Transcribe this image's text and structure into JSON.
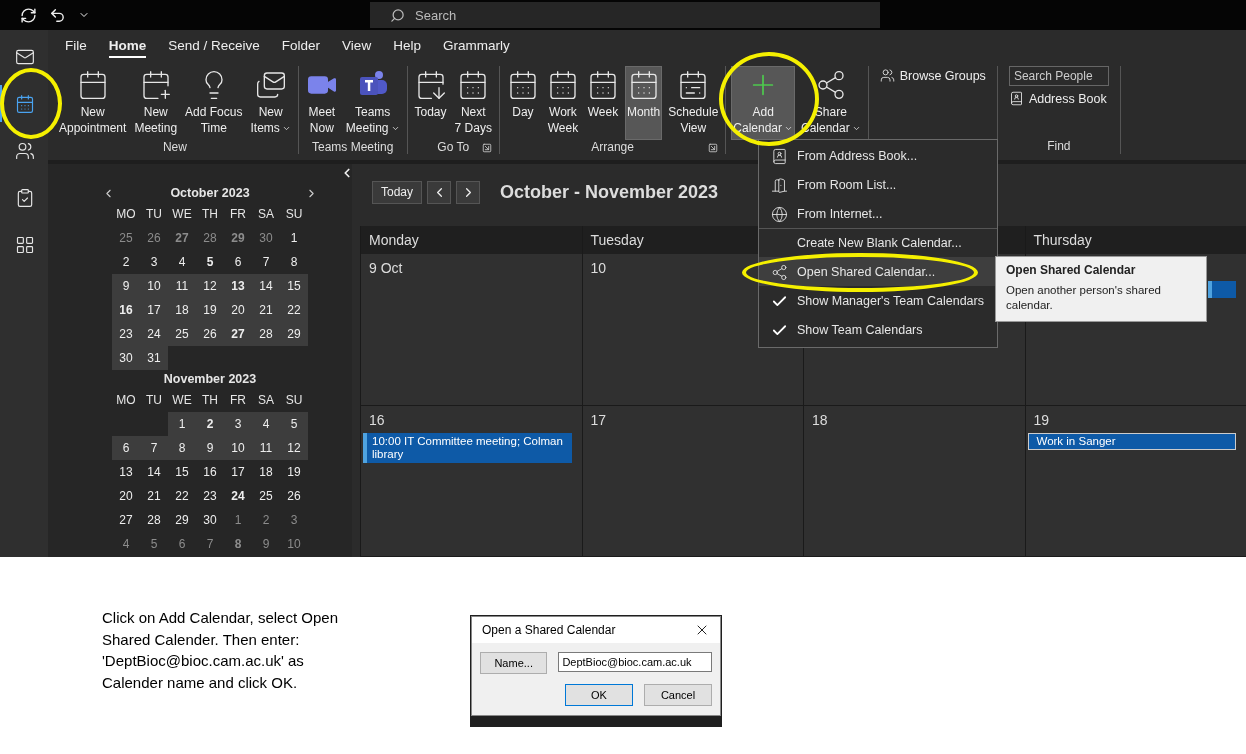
{
  "title_bar": {
    "search_placeholder": "Search"
  },
  "nav_rail": [
    {
      "kind": "mail",
      "selected": false,
      "circled": false
    },
    {
      "kind": "calendar",
      "selected": true,
      "circled": true
    },
    {
      "kind": "people",
      "selected": false,
      "circled": false
    },
    {
      "kind": "tasks",
      "selected": false,
      "circled": false
    },
    {
      "kind": "apps",
      "selected": false,
      "circled": false
    }
  ],
  "ribbon_tabs": [
    {
      "label": "File",
      "selected": false
    },
    {
      "label": "Home",
      "selected": true
    },
    {
      "label": "Send / Receive",
      "selected": false
    },
    {
      "label": "Folder",
      "selected": false
    },
    {
      "label": "View",
      "selected": false
    },
    {
      "label": "Help",
      "selected": false
    },
    {
      "label": "Grammarly",
      "selected": false
    }
  ],
  "ribbon_groups": [
    {
      "label": "New",
      "launcher": false,
      "items": [
        {
          "kind": "large",
          "lines": [
            "New",
            "Appointment"
          ],
          "dropdown": false,
          "selected": false,
          "circled": false
        },
        {
          "kind": "large",
          "lines": [
            "New",
            "Meeting"
          ],
          "dropdown": false,
          "selected": false,
          "circled": false
        },
        {
          "kind": "large",
          "lines": [
            "Add Focus",
            "Time"
          ],
          "dropdown": false,
          "selected": false,
          "circled": false
        },
        {
          "kind": "large",
          "lines": [
            "New",
            "Items"
          ],
          "dropdown": true,
          "selected": false,
          "circled": false
        }
      ]
    },
    {
      "label": "Teams Meeting",
      "launcher": false,
      "items": [
        {
          "kind": "large",
          "lines": [
            "Meet",
            "Now"
          ],
          "dropdown": false,
          "selected": false,
          "circled": false
        },
        {
          "kind": "large",
          "lines": [
            "Teams",
            "Meeting"
          ],
          "dropdown": true,
          "selected": false,
          "circled": false
        }
      ]
    },
    {
      "label": "Go To",
      "launcher": true,
      "items": [
        {
          "kind": "large",
          "lines": [
            "Today"
          ],
          "dropdown": false,
          "selected": false,
          "circled": false
        },
        {
          "kind": "large",
          "lines": [
            "Next",
            "7 Days"
          ],
          "dropdown": false,
          "selected": false,
          "circled": false
        }
      ]
    },
    {
      "label": "Arrange",
      "launcher": true,
      "items": [
        {
          "kind": "large",
          "lines": [
            "Day"
          ],
          "dropdown": false,
          "selected": false,
          "circled": false
        },
        {
          "kind": "large",
          "lines": [
            "Work",
            "Week"
          ],
          "dropdown": false,
          "selected": false,
          "circled": false
        },
        {
          "kind": "large",
          "lines": [
            "Week"
          ],
          "dropdown": false,
          "selected": false,
          "circled": false
        },
        {
          "kind": "large",
          "lines": [
            "Month"
          ],
          "dropdown": false,
          "selected": true,
          "circled": false
        },
        {
          "kind": "large",
          "lines": [
            "Schedule",
            "View"
          ],
          "dropdown": false,
          "selected": false,
          "circled": false
        }
      ]
    },
    {
      "launcher": false,
      "items": [
        {
          "kind": "large",
          "lines": [
            "Add",
            "Calendar"
          ],
          "dropdown": true,
          "selected": true,
          "circled": true
        },
        {
          "kind": "large",
          "lines": [
            "Share",
            "Calendar"
          ],
          "dropdown": true,
          "selected": false,
          "circled": false
        }
      ]
    },
    {
      "launcher": false,
      "items": [
        {
          "kind": "small",
          "text": "Browse Groups"
        }
      ]
    },
    {
      "label": "Find",
      "launcher": false,
      "items": [
        {
          "kind": "field",
          "placeholder": "Search People"
        },
        {
          "kind": "small",
          "text": "Address Book"
        }
      ]
    }
  ],
  "mini_calendars": [
    {
      "title": "October 2023",
      "nav": true,
      "weekdays": [
        "MO",
        "TU",
        "WE",
        "TH",
        "FR",
        "SA",
        "SU"
      ],
      "weeks": [
        [
          {
            "d": "25",
            "muted": true,
            "bold": false,
            "in_view": false
          },
          {
            "d": "26",
            "muted": true,
            "bold": false,
            "in_view": false
          },
          {
            "d": "27",
            "muted": true,
            "bold": true,
            "in_view": false
          },
          {
            "d": "28",
            "muted": true,
            "bold": false,
            "in_view": false
          },
          {
            "d": "29",
            "muted": true,
            "bold": true,
            "in_view": false
          },
          {
            "d": "30",
            "muted": true,
            "bold": false,
            "in_view": false
          },
          {
            "d": "1",
            "muted": false,
            "bold": false,
            "in_view": false
          }
        ],
        [
          {
            "d": "2",
            "muted": false,
            "bold": false,
            "in_view": false
          },
          {
            "d": "3",
            "muted": false,
            "bold": false,
            "in_view": false
          },
          {
            "d": "4",
            "muted": false,
            "bold": false,
            "in_view": false
          },
          {
            "d": "5",
            "muted": false,
            "bold": true,
            "in_view": false
          },
          {
            "d": "6",
            "muted": false,
            "bold": false,
            "in_view": false
          },
          {
            "d": "7",
            "muted": false,
            "bold": false,
            "in_view": false
          },
          {
            "d": "8",
            "muted": false,
            "bold": false,
            "in_view": false
          }
        ],
        [
          {
            "d": "9",
            "muted": false,
            "bold": false,
            "in_view": true
          },
          {
            "d": "10",
            "muted": false,
            "bold": false,
            "in_view": true
          },
          {
            "d": "11",
            "muted": false,
            "bold": false,
            "in_view": true
          },
          {
            "d": "12",
            "muted": false,
            "bold": false,
            "in_view": true
          },
          {
            "d": "13",
            "muted": false,
            "bold": true,
            "in_view": true
          },
          {
            "d": "14",
            "muted": false,
            "bold": false,
            "in_view": true
          },
          {
            "d": "15",
            "muted": false,
            "bold": false,
            "in_view": true
          }
        ],
        [
          {
            "d": "16",
            "muted": false,
            "bold": true,
            "in_view": true
          },
          {
            "d": "17",
            "muted": false,
            "bold": false,
            "in_view": true
          },
          {
            "d": "18",
            "muted": false,
            "bold": false,
            "in_view": true
          },
          {
            "d": "19",
            "muted": false,
            "bold": false,
            "in_view": true
          },
          {
            "d": "20",
            "muted": false,
            "bold": false,
            "in_view": true
          },
          {
            "d": "21",
            "muted": false,
            "bold": false,
            "in_view": true
          },
          {
            "d": "22",
            "muted": false,
            "bold": false,
            "in_view": true
          }
        ],
        [
          {
            "d": "23",
            "muted": false,
            "bold": false,
            "in_view": true
          },
          {
            "d": "24",
            "muted": false,
            "bold": false,
            "in_view": true
          },
          {
            "d": "25",
            "muted": false,
            "bold": false,
            "in_view": true
          },
          {
            "d": "26",
            "muted": false,
            "bold": false,
            "in_view": true
          },
          {
            "d": "27",
            "muted": false,
            "bold": true,
            "in_view": true
          },
          {
            "d": "28",
            "muted": false,
            "bold": false,
            "in_view": true
          },
          {
            "d": "29",
            "muted": false,
            "bold": false,
            "in_view": true
          }
        ],
        [
          {
            "d": "30",
            "muted": false,
            "bold": false,
            "in_view": true
          },
          {
            "d": "31",
            "muted": false,
            "bold": false,
            "in_view": true
          }
        ]
      ]
    },
    {
      "title": "November 2023",
      "nav": false,
      "weekdays": [
        "MO",
        "TU",
        "WE",
        "TH",
        "FR",
        "SA",
        "SU"
      ],
      "weeks": [
        [
          {
            "d": "1",
            "muted": false,
            "bold": false,
            "in_view": true
          },
          {
            "d": "2",
            "muted": false,
            "bold": true,
            "in_view": true
          },
          {
            "d": "3",
            "muted": false,
            "bold": false,
            "in_view": true
          },
          {
            "d": "4",
            "muted": false,
            "bold": false,
            "in_view": true
          },
          {
            "d": "5",
            "muted": false,
            "bold": false,
            "in_view": true
          }
        ],
        [
          {
            "d": "6",
            "muted": false,
            "bold": false,
            "in_view": true
          },
          {
            "d": "7",
            "muted": false,
            "bold": false,
            "in_view": true
          },
          {
            "d": "8",
            "muted": false,
            "bold": false,
            "in_view": true
          },
          {
            "d": "9",
            "muted": false,
            "bold": false,
            "in_view": true
          },
          {
            "d": "10",
            "muted": false,
            "bold": false,
            "in_view": true
          },
          {
            "d": "11",
            "muted": false,
            "bold": false,
            "in_view": true
          },
          {
            "d": "12",
            "muted": false,
            "bold": false,
            "in_view": true
          }
        ],
        [
          {
            "d": "13",
            "muted": false,
            "bold": false,
            "in_view": false
          },
          {
            "d": "14",
            "muted": false,
            "bold": false,
            "in_view": false
          },
          {
            "d": "15",
            "muted": false,
            "bold": false,
            "in_view": false
          },
          {
            "d": "16",
            "muted": false,
            "bold": false,
            "in_view": false
          },
          {
            "d": "17",
            "muted": false,
            "bold": false,
            "in_view": false
          },
          {
            "d": "18",
            "muted": false,
            "bold": false,
            "in_view": false
          },
          {
            "d": "19",
            "muted": false,
            "bold": false,
            "in_view": false
          }
        ],
        [
          {
            "d": "20",
            "muted": false,
            "bold": false,
            "in_view": false
          },
          {
            "d": "21",
            "muted": false,
            "bold": false,
            "in_view": false
          },
          {
            "d": "22",
            "muted": false,
            "bold": false,
            "in_view": false
          },
          {
            "d": "23",
            "muted": false,
            "bold": false,
            "in_view": false
          },
          {
            "d": "24",
            "muted": false,
            "bold": true,
            "in_view": false
          },
          {
            "d": "25",
            "muted": false,
            "bold": false,
            "in_view": false
          },
          {
            "d": "26",
            "muted": false,
            "bold": false,
            "in_view": false
          }
        ],
        [
          {
            "d": "27",
            "muted": false,
            "bold": false,
            "in_view": false
          },
          {
            "d": "28",
            "muted": false,
            "bold": false,
            "in_view": false
          },
          {
            "d": "29",
            "muted": false,
            "bold": false,
            "in_view": false
          },
          {
            "d": "30",
            "muted": false,
            "bold": false,
            "in_view": false
          },
          {
            "d": "1",
            "muted": true,
            "bold": false,
            "in_view": false
          },
          {
            "d": "2",
            "muted": true,
            "bold": false,
            "in_view": false
          },
          {
            "d": "3",
            "muted": true,
            "bold": false,
            "in_view": false
          }
        ],
        [
          {
            "d": "4",
            "muted": true,
            "bold": false,
            "in_view": false
          },
          {
            "d": "5",
            "muted": true,
            "bold": false,
            "in_view": false
          },
          {
            "d": "6",
            "muted": true,
            "bold": false,
            "in_view": false
          },
          {
            "d": "7",
            "muted": true,
            "bold": false,
            "in_view": false
          },
          {
            "d": "8",
            "muted": true,
            "bold": true,
            "in_view": false
          },
          {
            "d": "9",
            "muted": true,
            "bold": false,
            "in_view": false
          },
          {
            "d": "10",
            "muted": true,
            "bold": false,
            "in_view": false
          }
        ]
      ]
    }
  ],
  "calendar": {
    "today_button": "Today",
    "title": "October - November 2023",
    "columns": [
      "Monday",
      "Tuesday",
      null,
      "Thursday"
    ],
    "weeks": [
      {
        "col_1": {
          "date": "9 Oct"
        },
        "col_2": {
          "date": "10"
        },
        "col_4": {
          "events": [
            {
              "busy": true
            }
          ]
        }
      },
      {
        "col_1": {
          "date": "16",
          "events": [
            {
              "text": "10:00 IT Committee meeting; Colman library",
              "busy": true
            }
          ]
        },
        "col_2": {
          "date": "17"
        },
        "col_3": {
          "date": "18"
        },
        "col_4": {
          "date": "19",
          "events": [
            {
              "text": "Work in Sanger",
              "busy": false
            }
          ]
        }
      }
    ]
  },
  "add_calendar_menu": [
    {
      "label": "From Address Book...",
      "separator_before": false,
      "checked": false,
      "highlighted": false,
      "circled": false
    },
    {
      "label": "From Room List...",
      "separator_before": false,
      "checked": false,
      "highlighted": false,
      "circled": false
    },
    {
      "label": "From Internet...",
      "separator_before": false,
      "checked": false,
      "highlighted": false,
      "circled": false
    },
    {
      "label": "Create New Blank Calendar...",
      "separator_before": true,
      "checked": false,
      "highlighted": false,
      "circled": false
    },
    {
      "label": "Open Shared Calendar...",
      "separator_before": false,
      "checked": false,
      "highlighted": true,
      "circled": true
    },
    {
      "label": "Show Manager's Team Calendars",
      "separator_before": false,
      "checked": true,
      "highlighted": false,
      "circled": false
    },
    {
      "label": "Show Team Calendars",
      "separator_before": false,
      "checked": true,
      "highlighted": false,
      "circled": false
    }
  ],
  "tooltip": {
    "title": "Open Shared Calendar",
    "text": "Open another person's shared calendar."
  },
  "instructions": [
    "Click on Add Calendar, select Open",
    "Shared Calender. Then enter:",
    "'DeptBioc@bioc.cam.ac.uk' as",
    "Calender name and click OK."
  ],
  "dialog": {
    "title": "Open a Shared Calendar",
    "name_button": "Name...",
    "value": "DeptBioc@bioc.cam.ac.uk",
    "ok": "OK",
    "cancel": "Cancel"
  }
}
